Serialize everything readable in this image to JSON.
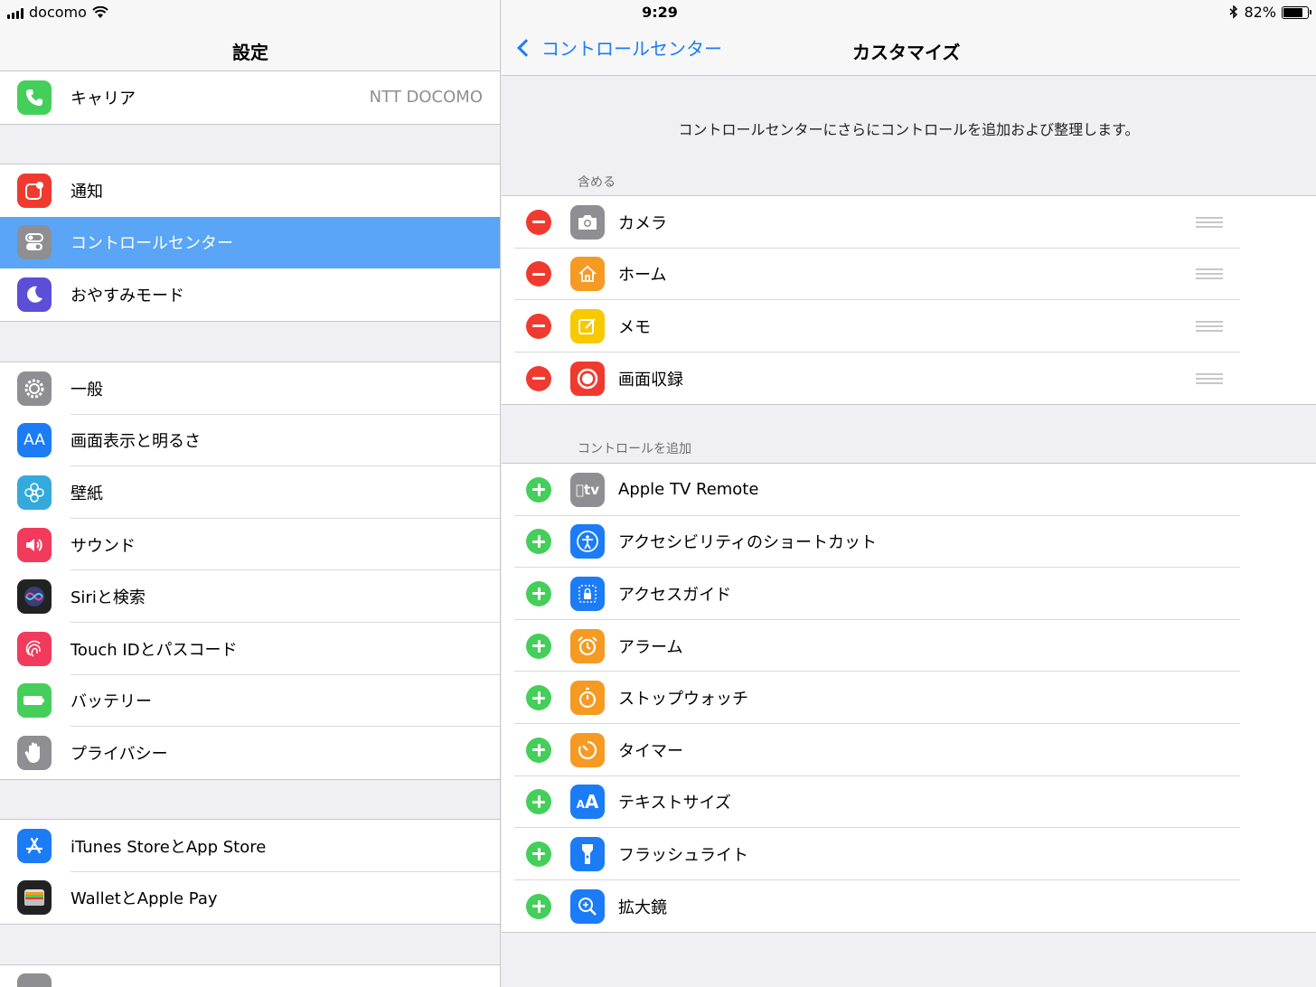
{
  "status": {
    "carrier": "docomo",
    "time": "9:29",
    "battery": "82%",
    "battery_level": 0.82
  },
  "left": {
    "title": "設定",
    "carrier_row": {
      "label": "キャリア",
      "value": "NTT DOCOMO"
    },
    "group1": [
      {
        "label": "通知",
        "icon": "notifications-icon",
        "color": "#f03a2f"
      },
      {
        "label": "コントロールセンター",
        "icon": "control-center-icon",
        "color": "#8e8e93",
        "selected": true
      },
      {
        "label": "おやすみモード",
        "icon": "moon-icon",
        "color": "#5b4fd8"
      }
    ],
    "group2": [
      {
        "label": "一般",
        "icon": "gear-icon",
        "color": "#8e8e93"
      },
      {
        "label": "画面表示と明るさ",
        "icon": "display-icon",
        "color": "#1b7cf6"
      },
      {
        "label": "壁紙",
        "icon": "wallpaper-icon",
        "color": "#34aadc"
      },
      {
        "label": "サウンド",
        "icon": "sound-icon",
        "color": "#f23a5c"
      },
      {
        "label": "Siriと検索",
        "icon": "siri-icon",
        "color": "#222"
      },
      {
        "label": "Touch IDとパスコード",
        "icon": "fingerprint-icon",
        "color": "#f23a5c"
      },
      {
        "label": "バッテリー",
        "icon": "battery-icon",
        "color": "#44cf5a"
      },
      {
        "label": "プライバシー",
        "icon": "hand-icon",
        "color": "#8e8e93"
      }
    ],
    "group3": [
      {
        "label": "iTunes StoreとApp Store",
        "icon": "app-store-icon",
        "color": "#1b7cf6"
      },
      {
        "label": "WalletとApple Pay",
        "icon": "wallet-icon",
        "color": "#222"
      }
    ]
  },
  "right": {
    "back_label": "コントロールセンター",
    "title": "カスタマイズ",
    "description": "コントロールセンターにさらにコントロールを追加および整理します。",
    "included_header": "含める",
    "included": [
      {
        "label": "カメラ",
        "icon": "camera-icon",
        "color": "#8e8e93"
      },
      {
        "label": "ホーム",
        "icon": "home-icon",
        "color": "#f59a23"
      },
      {
        "label": "メモ",
        "icon": "notes-icon",
        "color": "#f7c900"
      },
      {
        "label": "画面収録",
        "icon": "screen-record-icon",
        "color": "#f03a2f"
      }
    ],
    "more_header": "コントロールを追加",
    "more": [
      {
        "label": "Apple TV Remote",
        "icon": "apple-tv-icon",
        "color": "#8e8e93"
      },
      {
        "label": "アクセシビリティのショートカット",
        "icon": "accessibility-icon",
        "color": "#1b7cf6"
      },
      {
        "label": "アクセスガイド",
        "icon": "guided-access-icon",
        "color": "#1b7cf6"
      },
      {
        "label": "アラーム",
        "icon": "alarm-icon",
        "color": "#f59a23"
      },
      {
        "label": "ストップウォッチ",
        "icon": "stopwatch-icon",
        "color": "#f59a23"
      },
      {
        "label": "タイマー",
        "icon": "timer-icon",
        "color": "#f59a23"
      },
      {
        "label": "テキストサイズ",
        "icon": "text-size-icon",
        "color": "#1b7cf6"
      },
      {
        "label": "フラッシュライト",
        "icon": "flashlight-icon",
        "color": "#1b7cf6"
      },
      {
        "label": "拡大鏡",
        "icon": "magnifier-icon",
        "color": "#1b7cf6"
      }
    ]
  }
}
